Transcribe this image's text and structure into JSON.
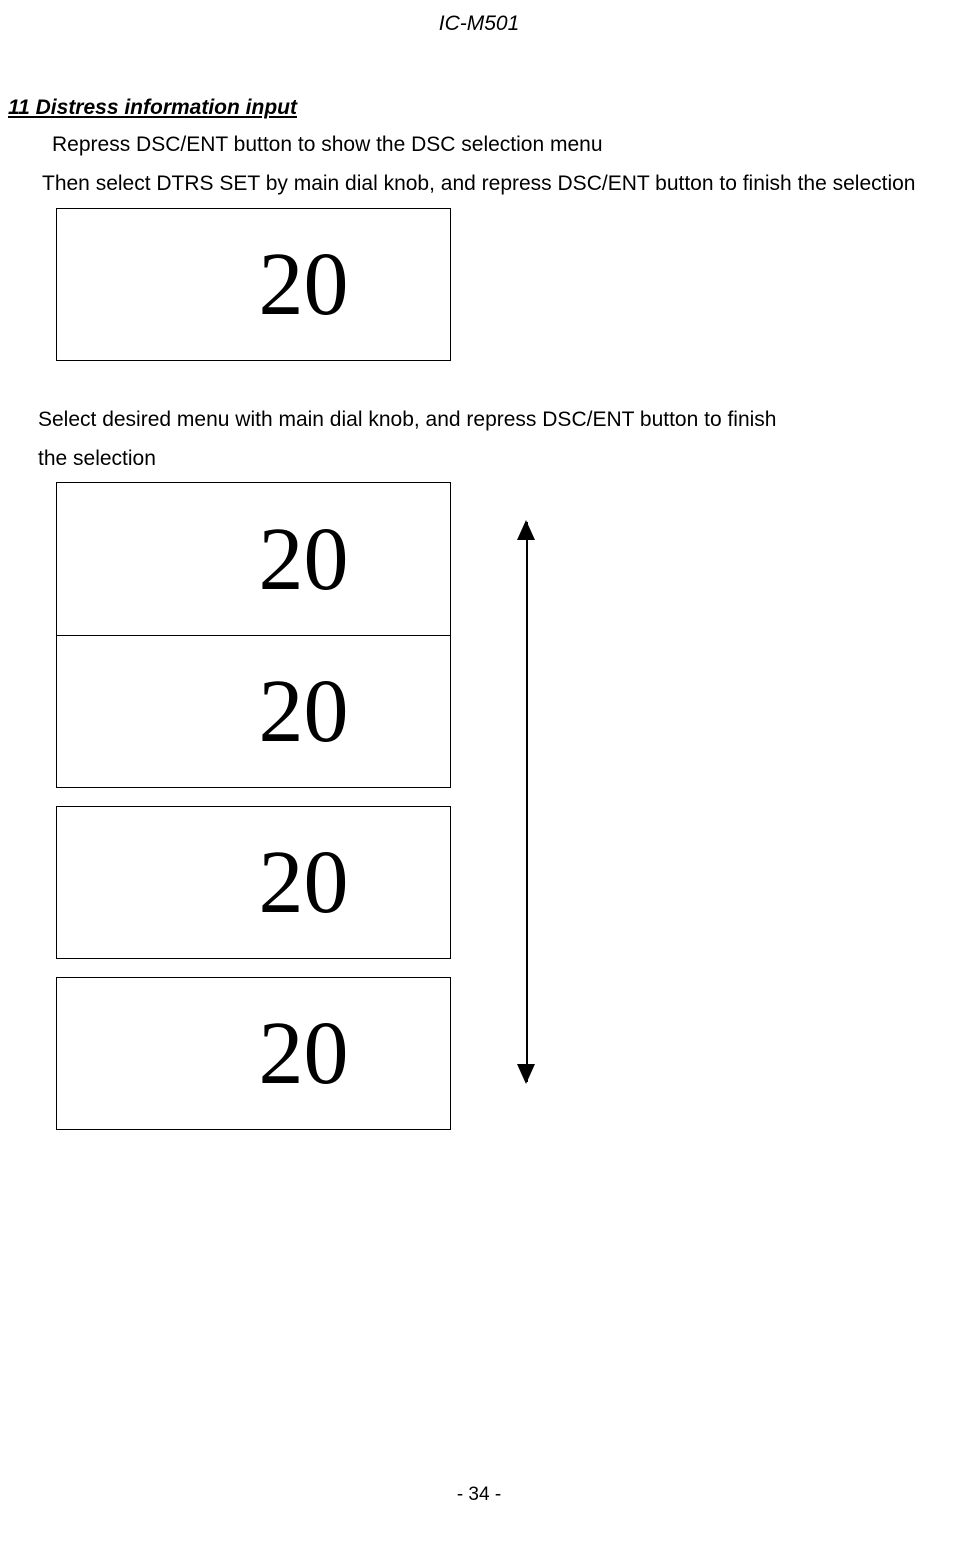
{
  "header": {
    "model": "IC-M501"
  },
  "section": {
    "heading": "11 Distress information input",
    "step1": "Repress DSC/ENT button to show the DSC selection menu",
    "step2": "Then select DTRS SET by main dial knob, and repress DSC/ENT button to finish the selection",
    "step3_line1": "Select desired menu with main dial knob, and repress DSC/ENT button to finish",
    "step3_line2": "the selection"
  },
  "displays": {
    "box1": "20",
    "box2": "20",
    "box3": "20",
    "box4": "20",
    "box5": "20"
  },
  "footer": {
    "page": "- 34 -"
  }
}
